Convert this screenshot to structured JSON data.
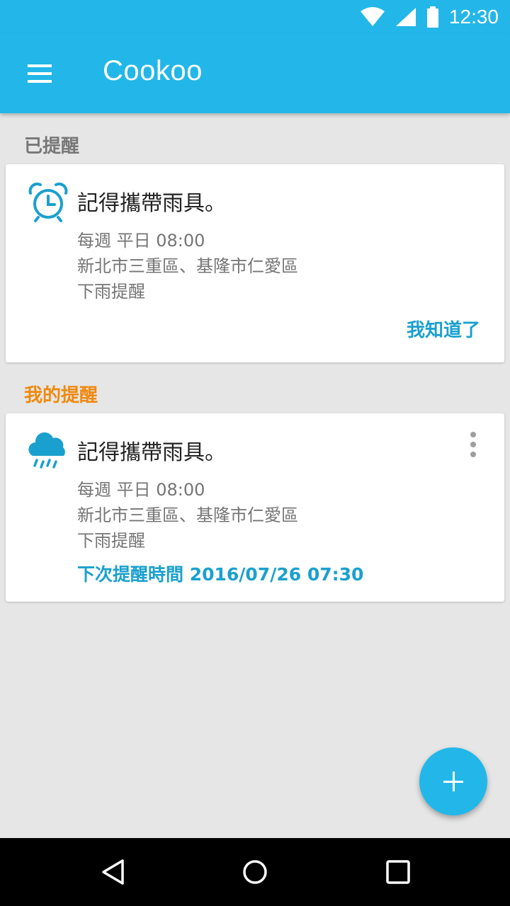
{
  "status_bar": {
    "time": "12:30",
    "icons": [
      "wifi-icon",
      "signal-icon",
      "battery-icon"
    ]
  },
  "app_bar": {
    "title": "Cookoo",
    "menu_icon": "menu-icon"
  },
  "sections": {
    "done": "已提醒",
    "mine": "我的提醒"
  },
  "reminded_card": {
    "icon": "alarm-clock-icon",
    "title": "記得攜帶雨具。",
    "schedule": "每週 平日 08:00",
    "locations": "新北市三重區、基隆市仁愛區",
    "condition": "下雨提醒",
    "ack_label": "我知道了"
  },
  "my_card": {
    "icon": "rain-cloud-icon",
    "title": "記得攜帶雨具。",
    "schedule": "每週 平日 08:00",
    "locations": "新北市三重區、基隆市仁愛區",
    "condition": "下雨提醒",
    "next_time": "下次提醒時間 2016/07/26 07:30"
  },
  "fab": {
    "icon": "plus-icon"
  },
  "nav_bar": {
    "icons": [
      "back-icon",
      "home-icon",
      "recents-icon"
    ]
  },
  "colors": {
    "primary": "#22b7e8",
    "accent_blue": "#1aa0cf",
    "accent_orange": "#f0890e",
    "background": "#e6e6e6"
  }
}
